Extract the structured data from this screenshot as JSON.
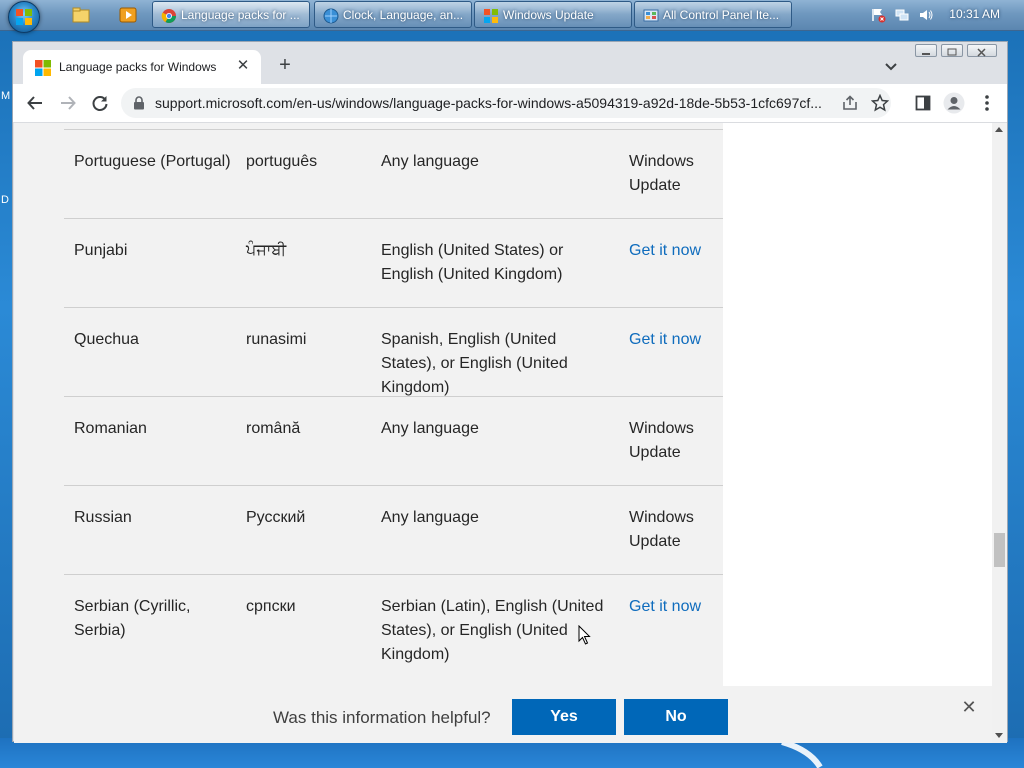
{
  "taskbar": {
    "tasks": [
      {
        "label": "Language packs for ...",
        "active": true
      },
      {
        "label": "Clock, Language, an...",
        "active": false
      },
      {
        "label": "Windows Update",
        "active": false
      },
      {
        "label": "All Control Panel Ite...",
        "active": false
      }
    ],
    "clock": "10:31 AM"
  },
  "desktop": {
    "edge_letters": [
      "M",
      "D"
    ]
  },
  "browser": {
    "tab_title": "Language packs for Windows",
    "new_tab": "+",
    "tab_close": "✕",
    "url": "support.microsoft.com/en-us/windows/language-packs-for-windows-a5094319-a92d-18de-5b53-1cfc697cf..."
  },
  "table": {
    "rows": [
      {
        "language": "Portuguese (Portugal)",
        "native": "português",
        "base": "Any language",
        "get": "Windows Update",
        "is_link": false
      },
      {
        "language": "Punjabi",
        "native": "ਪੰਜਾਬੀ",
        "base": "English (United States) or English (United Kingdom)",
        "get": "Get it now",
        "is_link": true
      },
      {
        "language": "Quechua",
        "native": "runasimi",
        "base": "Spanish, English (United States), or English (United Kingdom)",
        "get": "Get it now",
        "is_link": true
      },
      {
        "language": "Romanian",
        "native": "română",
        "base": "Any language",
        "get": "Windows Update",
        "is_link": false
      },
      {
        "language": "Russian",
        "native": "Русский",
        "base": "Any language",
        "get": "Windows Update",
        "is_link": false
      },
      {
        "language": "Serbian (Cyrillic, Serbia)",
        "native": "српски",
        "base": "Serbian (Latin), English (United States), or English (United Kingdom)",
        "get": "Get it now",
        "is_link": true
      }
    ]
  },
  "feedback": {
    "question": "Was this information helpful?",
    "yes": "Yes",
    "no": "No",
    "close": "✕"
  },
  "colors": {
    "link": "#0f6cbd",
    "button": "#0067b8",
    "table_bg": "#f2f2f2"
  }
}
